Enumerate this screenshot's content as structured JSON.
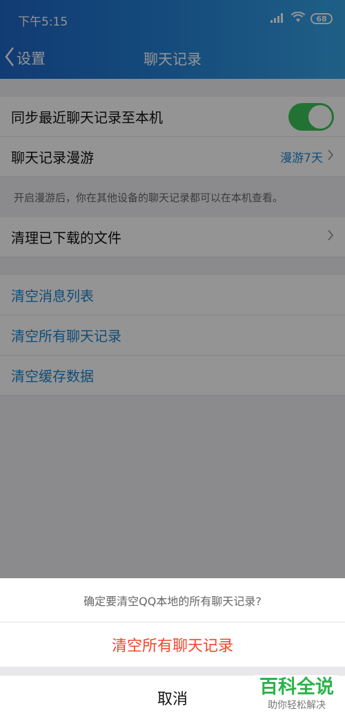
{
  "status_bar": {
    "time": "下午5:15",
    "battery": "68"
  },
  "nav": {
    "back_label": "设置",
    "title": "聊天记录"
  },
  "settings": {
    "sync_label": "同步最近聊天记录至本机",
    "sync_enabled": true,
    "roaming_label": "聊天记录漫游",
    "roaming_value": "漫游7天",
    "roaming_note": "开启漫游后，你在其他设备的聊天记录都可以在本机查看。",
    "clean_files_label": "清理已下载的文件",
    "clear_list_label": "清空消息列表",
    "clear_all_label": "清空所有聊天记录",
    "clear_cache_label": "清空缓存数据"
  },
  "action_sheet": {
    "prompt": "确定要清空QQ本地的所有聊天记录?",
    "confirm_label": "清空所有聊天记录",
    "cancel_label": "取消"
  },
  "watermark": {
    "title": "百科全说",
    "subtitle": "助你轻松解决"
  },
  "colors": {
    "accent_blue": "#1b86d1",
    "toggle_on": "#3cc45a",
    "destructive": "#f0462a",
    "header": "#1e67c7"
  }
}
